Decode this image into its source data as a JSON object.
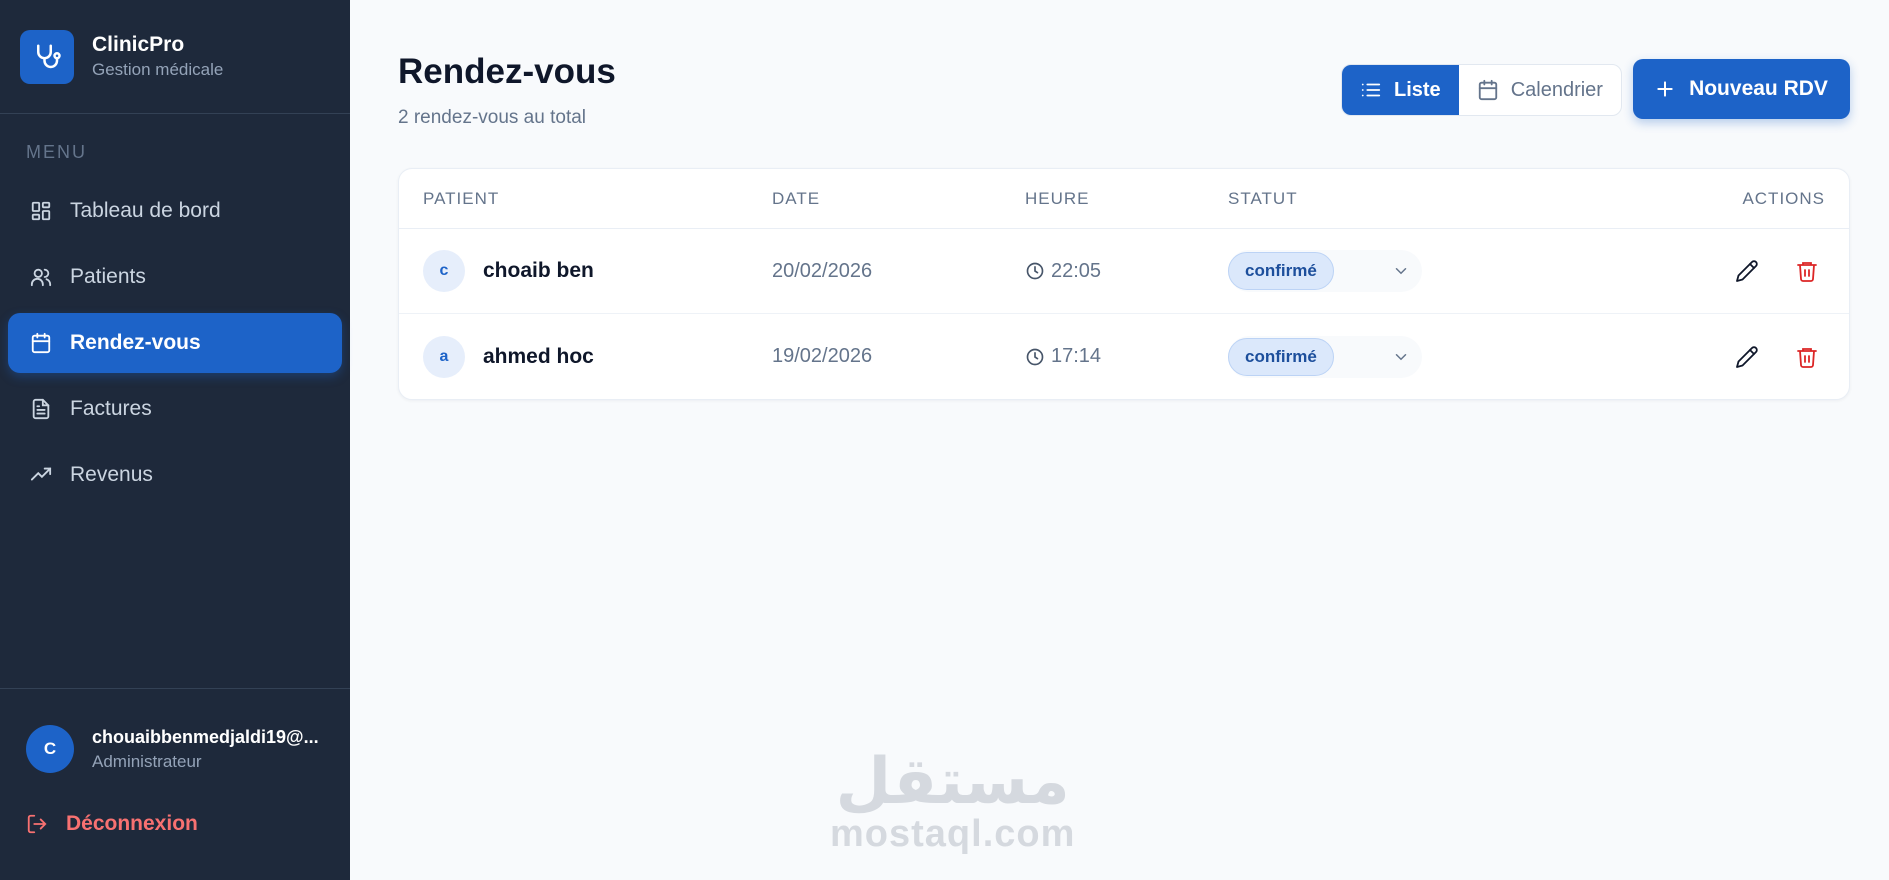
{
  "brand": {
    "name": "ClinicPro",
    "subtitle": "Gestion médicale"
  },
  "sidebar": {
    "menu_label": "MENU",
    "items": [
      {
        "label": "Tableau de bord",
        "icon": "dashboard-icon"
      },
      {
        "label": "Patients",
        "icon": "users-icon"
      },
      {
        "label": "Rendez-vous",
        "icon": "calendar-icon",
        "active": true
      },
      {
        "label": "Factures",
        "icon": "file-icon"
      },
      {
        "label": "Revenus",
        "icon": "trending-up-icon"
      }
    ],
    "user": {
      "initial": "C",
      "email": "chouaibbenmedjaldi19@...",
      "role": "Administrateur"
    },
    "logout_label": "Déconnexion"
  },
  "header": {
    "title": "Rendez-vous",
    "subtitle": "2 rendez-vous au total",
    "toggle": {
      "list_label": "Liste",
      "calendar_label": "Calendrier",
      "active": "list"
    },
    "new_button_label": "Nouveau RDV"
  },
  "table": {
    "columns": {
      "patient": "PATIENT",
      "date": "DATE",
      "heure": "HEURE",
      "statut": "STATUT",
      "actions": "ACTIONS"
    },
    "rows": [
      {
        "initial": "c",
        "patient": "choaib ben",
        "date": "20/02/2026",
        "heure": "22:05",
        "statut": "confirmé"
      },
      {
        "initial": "a",
        "patient": "ahmed hoc",
        "date": "19/02/2026",
        "heure": "17:14",
        "statut": "confirmé"
      }
    ]
  },
  "watermark": {
    "arabic": "مستقل",
    "latin": "mostaql.com"
  },
  "colors": {
    "sidebar_bg": "#1e293b",
    "accent": "#1d63c8",
    "danger": "#dc2626",
    "page_bg": "#f8fafc"
  }
}
